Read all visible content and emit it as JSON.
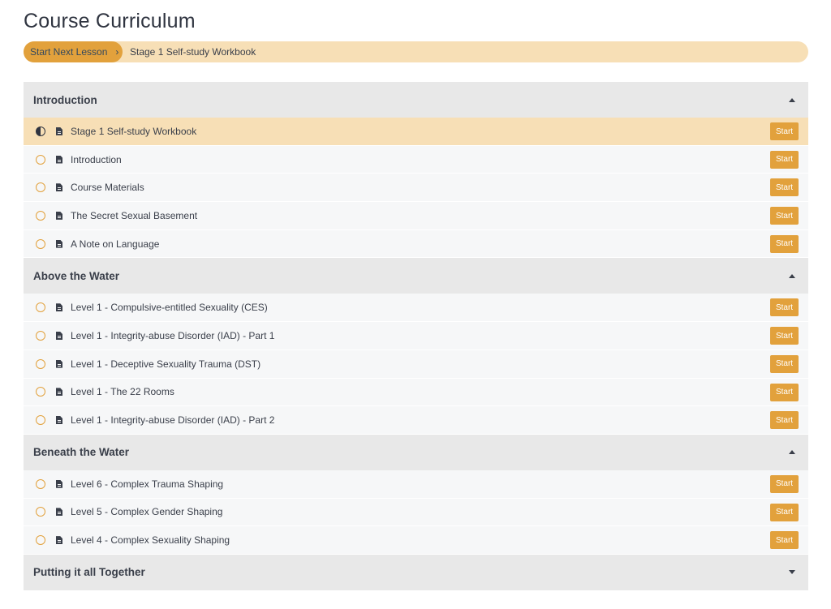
{
  "page": {
    "title": "Course Curriculum"
  },
  "next": {
    "button_label": "Start Next Lesson",
    "chevron": "›",
    "lesson": "Stage 1 Self-study Workbook"
  },
  "colors": {
    "accent": "#e2a13c",
    "accent_light": "#f7dfb6",
    "header_bg": "#e8e8e8",
    "row_bg": "#f6f7f8"
  },
  "start_label": "Start",
  "sections": [
    {
      "title": "Introduction",
      "expanded": true,
      "lessons": [
        {
          "title": "Stage 1 Self-study Workbook",
          "status": "in-progress",
          "current": true
        },
        {
          "title": "Introduction",
          "status": "not-started"
        },
        {
          "title": "Course Materials",
          "status": "not-started"
        },
        {
          "title": "The Secret Sexual Basement",
          "status": "not-started"
        },
        {
          "title": "A Note on Language",
          "status": "not-started"
        }
      ]
    },
    {
      "title": "Above the Water",
      "expanded": true,
      "lessons": [
        {
          "title": "Level 1 - Compulsive-entitled Sexuality (CES)",
          "status": "not-started"
        },
        {
          "title": "Level 1 - Integrity-abuse Disorder (IAD) - Part 1",
          "status": "not-started"
        },
        {
          "title": "Level 1 - Deceptive Sexuality Trauma (DST)",
          "status": "not-started"
        },
        {
          "title": "Level 1 - The 22 Rooms",
          "status": "not-started"
        },
        {
          "title": "Level 1 - Integrity-abuse Disorder (IAD) - Part 2",
          "status": "not-started"
        }
      ]
    },
    {
      "title": "Beneath the Water",
      "expanded": true,
      "lessons": [
        {
          "title": "Level 6 - Complex Trauma Shaping",
          "status": "not-started"
        },
        {
          "title": "Level 5 - Complex Gender Shaping",
          "status": "not-started"
        },
        {
          "title": "Level 4 - Complex Sexuality Shaping",
          "status": "not-started"
        }
      ]
    },
    {
      "title": "Putting it all Together",
      "expanded": false,
      "lessons": []
    }
  ]
}
